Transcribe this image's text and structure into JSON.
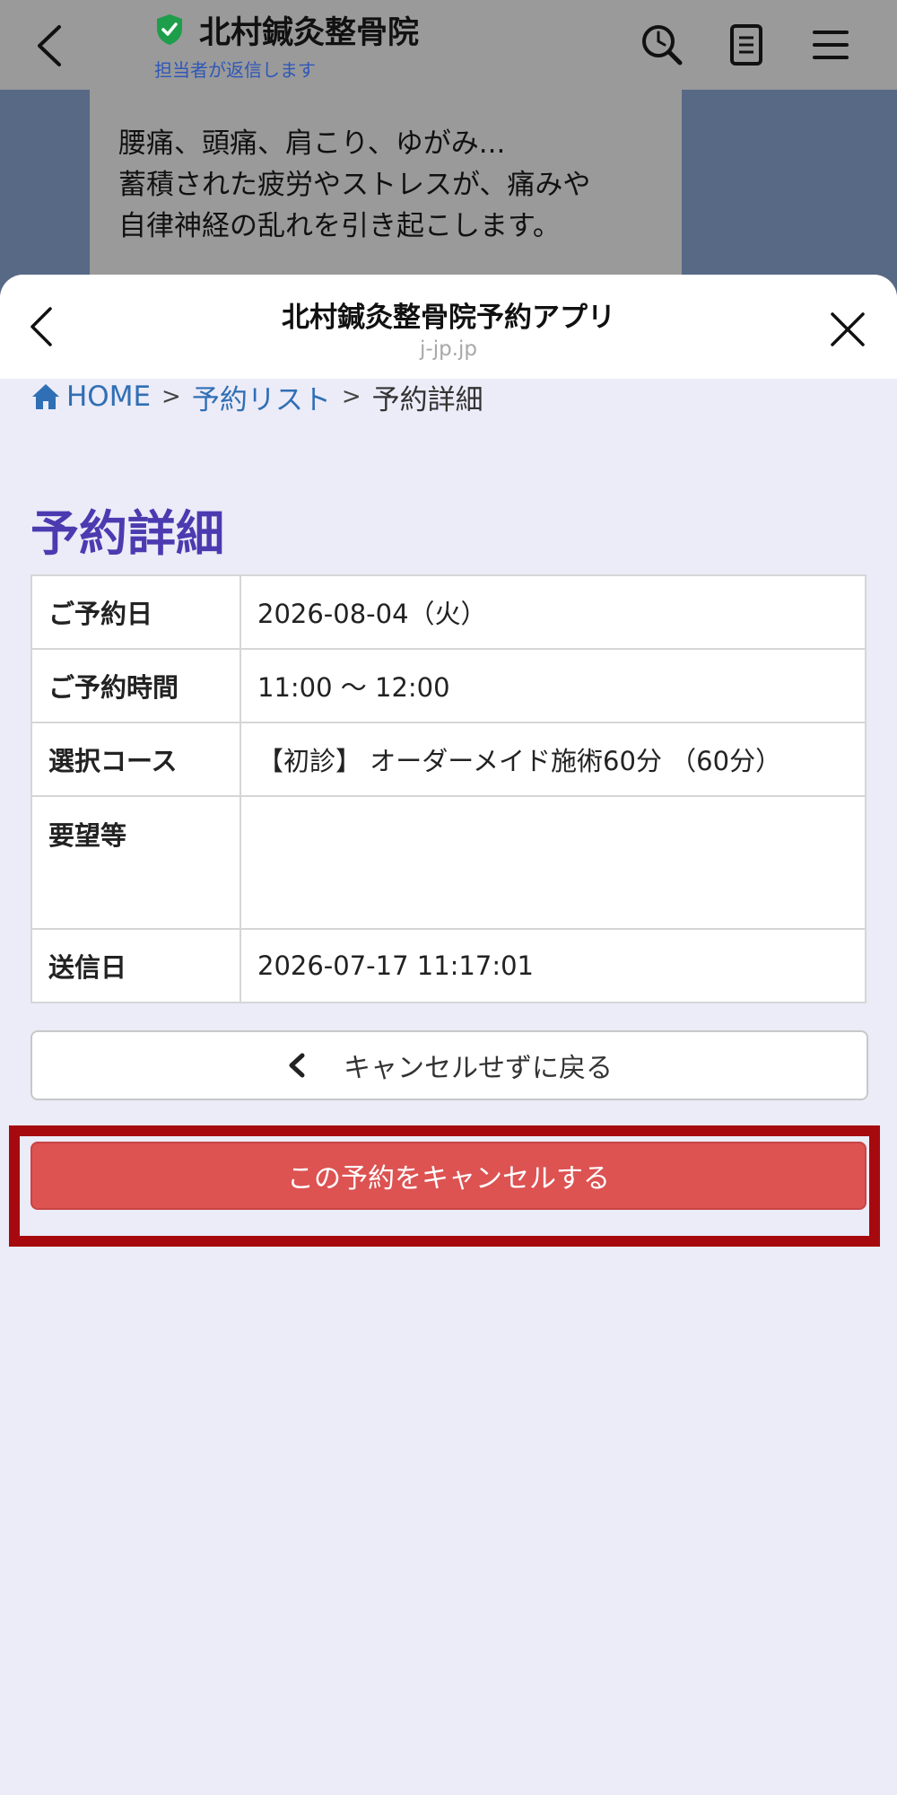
{
  "chat_header": {
    "title": "北村鍼灸整骨院",
    "subtitle": "担当者が返信します"
  },
  "chat_message": {
    "lines": [
      "腰痛、頭痛、肩こり、ゆがみ...",
      "蓄積された疲労やストレスが、痛みや",
      "自律神経の乱れを引き起こします。"
    ]
  },
  "sheet": {
    "title": "北村鍼灸整骨院予約アプリ",
    "url": "j-jp.jp"
  },
  "breadcrumb": {
    "home": "HOME",
    "sep": ">",
    "list": "予約リスト",
    "current": "予約詳細"
  },
  "page": {
    "title": "予約詳細"
  },
  "details": [
    {
      "label": "ご予約日",
      "value": "2026-08-04（火）"
    },
    {
      "label": "ご予約時間",
      "value": "11:00 〜 12:00"
    },
    {
      "label": "選択コース",
      "value": "【初診】 オーダーメイド施術60分 （60分）"
    },
    {
      "label": "要望等",
      "value": ""
    },
    {
      "label": "送信日",
      "value": "2026-07-17 11:17:01"
    }
  ],
  "buttons": {
    "back": "キャンセルせずに戻る",
    "cancel": "この予約をキャンセルする"
  },
  "colors": {
    "title_purple": "#4A3BB0",
    "link_blue": "#2F6FB5",
    "cancel_red": "#DC5352",
    "highlight_frame": "#A60A0F",
    "verified_green": "#1E9E4A"
  },
  "icons": {
    "chat_back": "chevron-left-icon",
    "verified": "shield-check-icon",
    "search": "search-icon",
    "notes": "note-icon",
    "menu": "menu-icon",
    "sheet_back": "chevron-left-icon",
    "sheet_close": "close-icon",
    "home": "home-icon",
    "back_button": "chevron-left-icon"
  }
}
